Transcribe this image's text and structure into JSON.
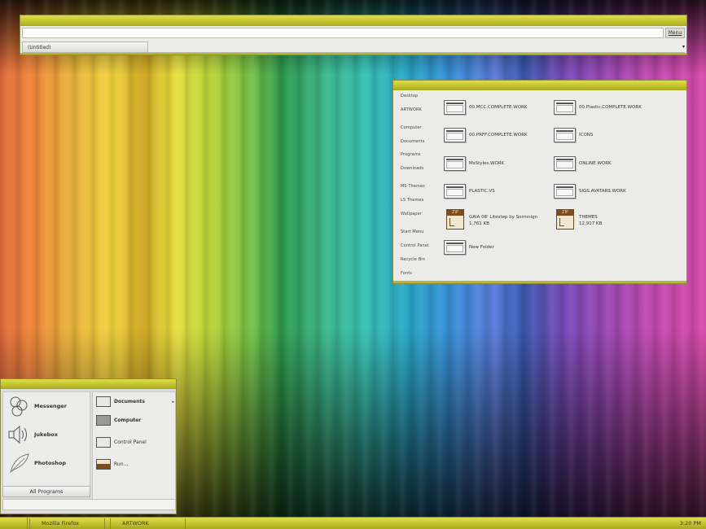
{
  "browser": {
    "menu_label": "Menu",
    "tab_label": "(Untitled)",
    "tabs_dropdown": "▾"
  },
  "explorer": {
    "nav": [
      "Desktop",
      "ARTWORK",
      "Computer",
      "Documents",
      "Programs",
      "Downloads",
      "MS Themes",
      "LS Themes",
      "Wallpaper",
      "Start Menu",
      "Control Panel",
      "Recycle Bin",
      "Fonts"
    ],
    "files": [
      {
        "name": "00.MCC.COMPLETE.WORK",
        "type": "folder"
      },
      {
        "name": "00.Plastic.COMPLETE.WORK",
        "type": "folder"
      },
      {
        "name": "00.PRFF.COMPLETE.WORK",
        "type": "folder"
      },
      {
        "name": "ICONS",
        "type": "folder"
      },
      {
        "name": "MsStyles.WORK",
        "type": "folder"
      },
      {
        "name": "ONLINE.WORK",
        "type": "folder"
      },
      {
        "name": "PLASTIC.VS",
        "type": "folder"
      },
      {
        "name": "SIGS.AVATARS.WORK",
        "type": "folder"
      },
      {
        "name": "GAIA 08' Litestep by Sormnign",
        "size": "1,761 KB",
        "type": "zip"
      },
      {
        "name": "THEMES",
        "size": "12,917 KB",
        "type": "zip"
      },
      {
        "name": "New Folder",
        "type": "folder"
      }
    ],
    "zip_label": "ZIP"
  },
  "startmenu": {
    "programs": [
      {
        "label": "Messenger",
        "icon": "messenger-icon"
      },
      {
        "label": "Jukebox",
        "icon": "speaker-icon"
      },
      {
        "label": "Photoshop",
        "icon": "feather-icon"
      }
    ],
    "all_programs": "All Programs",
    "places": [
      {
        "label": "Documents",
        "icon": "documents-icon",
        "bold": true,
        "submenu_arrow": "▸"
      },
      {
        "label": "Computer",
        "icon": "computer-icon",
        "bold": true
      },
      {
        "label": "Control Panel",
        "icon": "control-panel-icon",
        "bold": false
      },
      {
        "label": "Run...",
        "icon": "run-icon",
        "bold": false
      }
    ]
  },
  "taskbar": {
    "tasks": [
      "Mozilla Firefox",
      "ARTWORK"
    ],
    "clock": "3:20 PM"
  },
  "colors": {
    "accent": "#c8c834",
    "accent_dark": "#8a8a40",
    "window_bg": "#ebebe9"
  }
}
